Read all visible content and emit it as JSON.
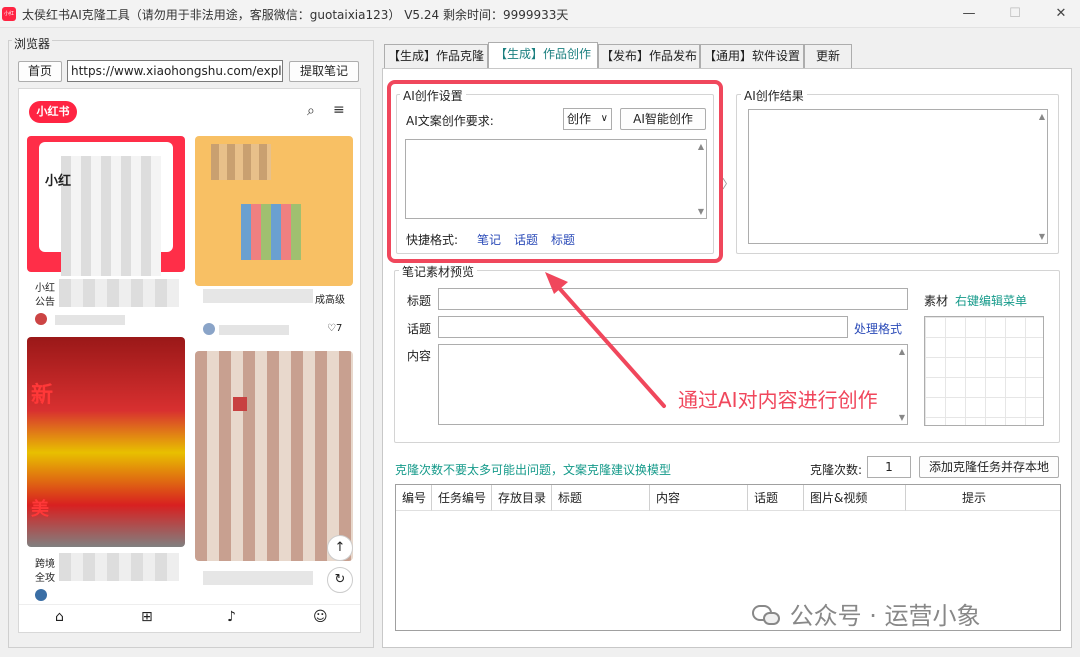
{
  "window": {
    "title": "太侯红书AI克隆工具（请勿用于非法用途，客服微信：guotaixia123）  V5.24  剩余时间：9999933天",
    "icon_text": "小红书",
    "controls": [
      "—",
      "☐",
      "✕"
    ]
  },
  "browser": {
    "label": "浏览器",
    "home_label": "首页",
    "url": "https://www.xiaohongshu.com/explor",
    "fetch_label": "提取笔记",
    "logo": "小红书",
    "cards": [
      {
        "text": "小红",
        "sub": "公告",
        "likes": ""
      },
      {
        "text": "",
        "sub": "成高级",
        "likes": "♡7"
      },
      {
        "text": "新",
        "sub": "",
        "likes": ""
      },
      {
        "text": "",
        "sub": "",
        "likes": ""
      }
    ],
    "card3_text": "美",
    "card3_sub": "跨境",
    "card3_sub2": "全攻"
  },
  "tabs": [
    {
      "label": "【生成】作品克隆",
      "active": false
    },
    {
      "label": "【生成】作品创作",
      "active": true
    },
    {
      "label": "【发布】作品发布",
      "active": false
    },
    {
      "label": "【通用】软件设置",
      "active": false
    },
    {
      "label": "更新",
      "active": false
    }
  ],
  "ai_settings": {
    "title": "AI创作设置",
    "req_label": "AI文案创作要求:",
    "mode_value": "创作",
    "create_button": "AI智能创作",
    "quick_label": "快捷格式:",
    "quick_links": [
      "笔记",
      "话题",
      "标题"
    ]
  },
  "ai_result": {
    "title": "AI创作结果"
  },
  "note_preview": {
    "title": "笔记素材预览",
    "title_label": "标题",
    "topic_label": "话题",
    "content_label": "内容",
    "process_link": "处理格式",
    "material_label": "素材",
    "material_link": "右键编辑菜单"
  },
  "clone": {
    "tip": "克隆次数不要太多可能出问题，文案克隆建议换模型",
    "count_label": "克隆次数:",
    "count_value": "1",
    "add_button": "添加克隆任务并存本地"
  },
  "table": {
    "headers": [
      "编号",
      "任务编号",
      "存放目录",
      "标题",
      "内容",
      "话题",
      "图片&视频",
      "提示"
    ]
  },
  "annotation": {
    "text": "通过AI对内容进行创作"
  },
  "watermark": {
    "text": "公众号 · 运营小象"
  },
  "colors": {
    "accent_red": "#f0475c",
    "link_blue": "#2b4bb8",
    "teal": "#159a8a",
    "brand_red": "#ff2442"
  }
}
